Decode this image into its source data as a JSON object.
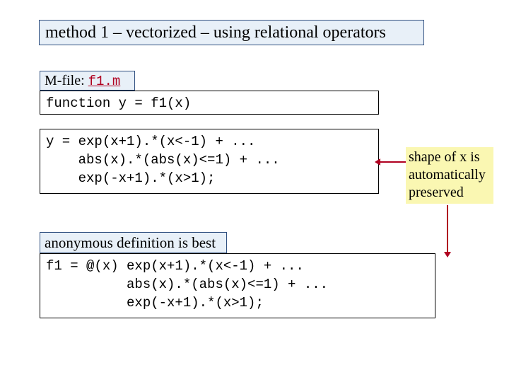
{
  "title": "method 1 – vectorized – using relational operators",
  "mfile": {
    "label_prefix": "M-file: ",
    "filename": "f1.m"
  },
  "code": {
    "signature": "function y = f1(x)",
    "body": "y = exp(x+1).*(x<-1) + ...\n    abs(x).*(abs(x)<=1) + ...\n    exp(-x+1).*(x>1);"
  },
  "anon": {
    "label": "anonymous definition is best",
    "code": "f1 = @(x) exp(x+1).*(x<-1) + ...\n          abs(x).*(abs(x)<=1) + ...\n          exp(-x+1).*(x>1);"
  },
  "note": "shape of x is automatically preserved"
}
